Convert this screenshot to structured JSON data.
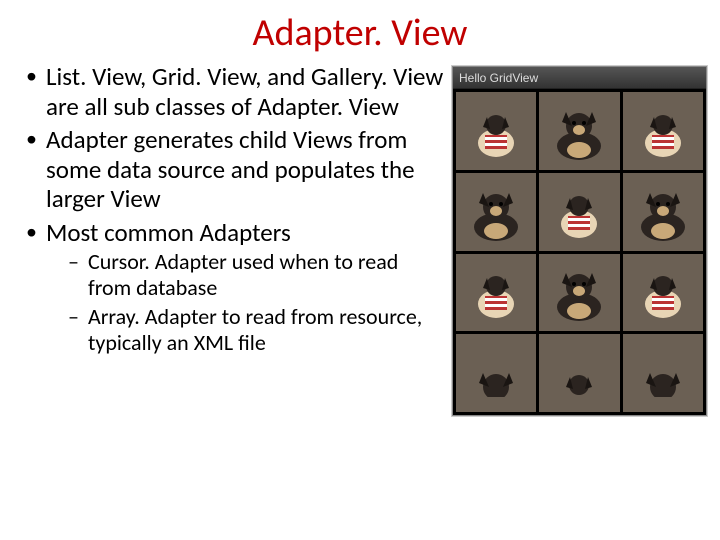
{
  "title": "Adapter. View",
  "bullets": {
    "b1": "List. View, Grid. View, and Gallery. View are all sub classes of Adapter. View",
    "b2": "Adapter generates child Views from some data source and populates the larger View",
    "b3": "Most common Adapters",
    "s1": "Cursor. Adapter used when to read from database",
    "s2": "Array. Adapter to read from resource, typically an XML file"
  },
  "phone": {
    "header": "Hello GridView"
  }
}
